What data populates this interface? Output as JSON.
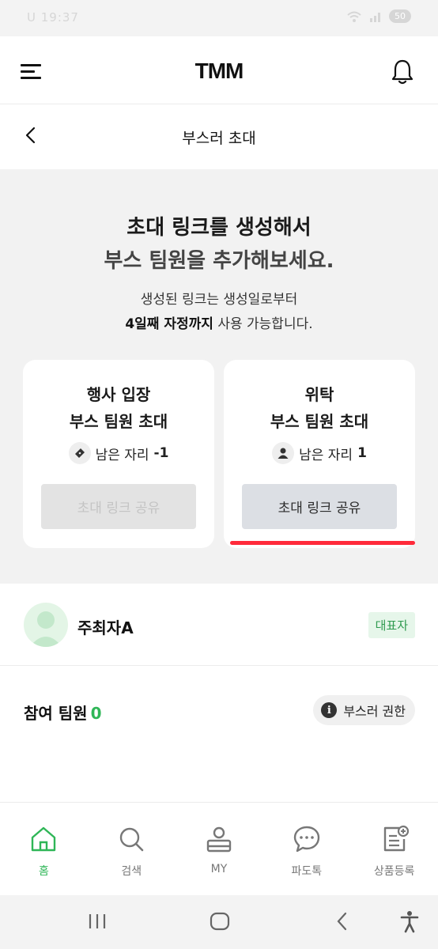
{
  "status_bar": {
    "time": "U 19:37",
    "battery": "50"
  },
  "header": {
    "logo": "TMM"
  },
  "sub_header": {
    "title": "부스러 초대"
  },
  "invite": {
    "headline_line1": "초대 링크를 생성해서",
    "headline_line2": "부스 팀원을 추가해보세요.",
    "desc_line1": "생성된 링크는 생성일로부터",
    "desc_line2_bold": "4일째 자정까지",
    "desc_line2_rest": " 사용 가능합니다.",
    "cards": [
      {
        "title_line1": "행사 입장",
        "title_line2": "부스 팀원 초대",
        "seat_label": "남은 자리",
        "seat_count": "-1",
        "share_label": "초대 링크 공유",
        "enabled": false
      },
      {
        "title_line1": "위탁",
        "title_line2": "부스 팀원 초대",
        "seat_label": "남은 자리",
        "seat_count": "1",
        "share_label": "초대 링크 공유",
        "enabled": true
      }
    ]
  },
  "host": {
    "name": "주최자A",
    "badge": "대표자"
  },
  "team": {
    "label": "참여 팀원",
    "count": "0",
    "permission_label": "부스러 권한",
    "info_glyph": "i"
  },
  "bottom_nav": [
    {
      "label": "홈",
      "icon": "home-icon",
      "active": true
    },
    {
      "label": "검색",
      "icon": "search-icon",
      "active": false
    },
    {
      "label": "MY",
      "icon": "person-icon",
      "active": false
    },
    {
      "label": "파도톡",
      "icon": "chat-bubble-icon",
      "active": false
    },
    {
      "label": "상품등록",
      "icon": "product-register-icon",
      "active": false
    }
  ],
  "colors": {
    "accent_green": "#2fb657",
    "annotation_red": "#ff2a3a",
    "section_bg": "#f2f2f2"
  }
}
